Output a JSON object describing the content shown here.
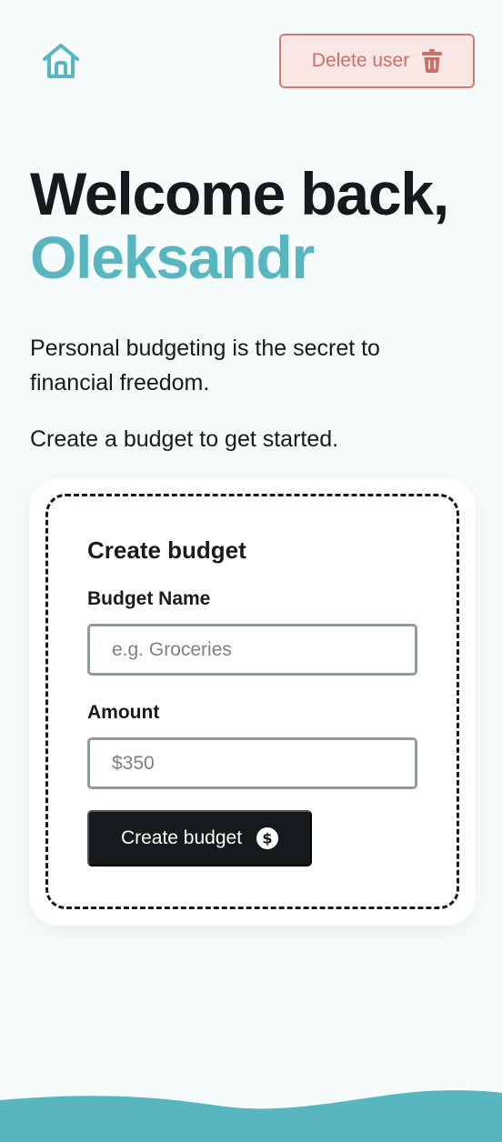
{
  "header": {
    "home_icon": "home-icon",
    "delete_label": "Delete user",
    "delete_icon": "trash-icon"
  },
  "hero": {
    "greeting": "Welcome back,",
    "name": "Oleksandr",
    "intro": "Personal budgeting is the secret to financial freedom.",
    "cta_text": "Create a budget to get started."
  },
  "form": {
    "title": "Create budget",
    "name_label": "Budget Name",
    "name_placeholder": "e.g. Groceries",
    "name_value": "",
    "amount_label": "Amount",
    "amount_placeholder": "$350",
    "amount_value": "",
    "submit_label": "Create budget",
    "submit_icon": "dollar-circle-icon"
  },
  "colors": {
    "accent": "#58b6c1",
    "danger": "#cc6f69",
    "danger_bg": "#f9e7e6",
    "dark": "#151b1d",
    "background": "#f6fbfc"
  }
}
